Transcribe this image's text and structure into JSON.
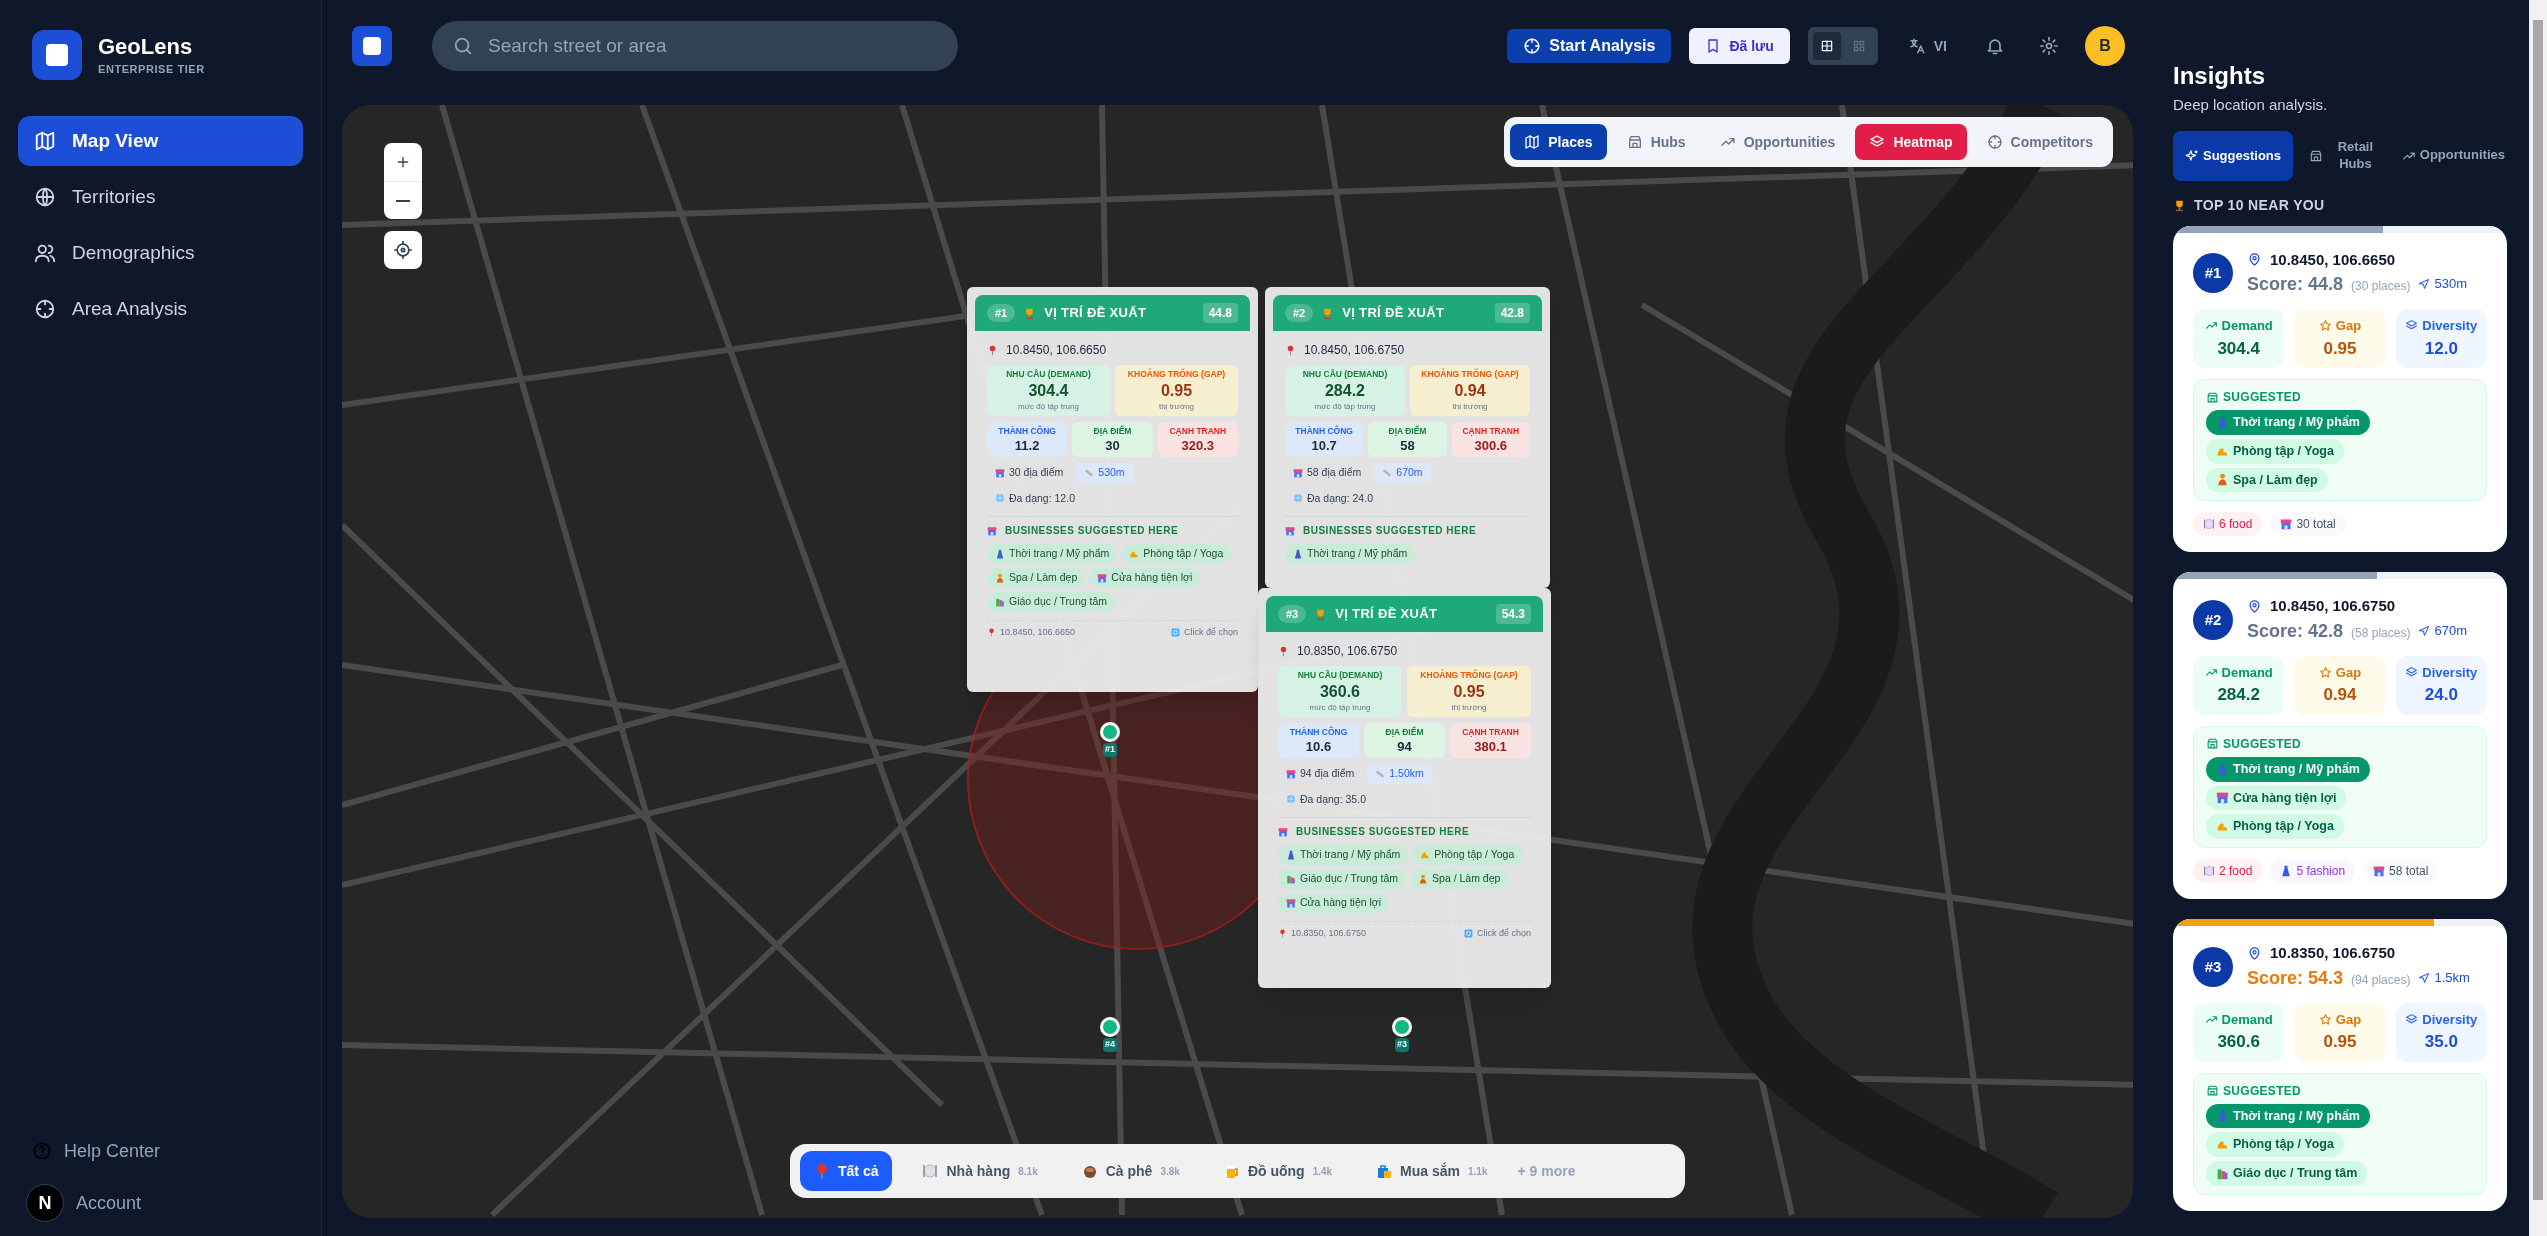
{
  "sidebar": {
    "brand": "GeoLens",
    "tier": "ENTERPRISE TIER",
    "items": [
      {
        "label": "Map View",
        "selected": true,
        "kind": "map"
      },
      {
        "label": "Territories",
        "selected": false,
        "kind": "globe"
      },
      {
        "label": "Demographics",
        "selected": false,
        "kind": "users"
      },
      {
        "label": "Area Analysis",
        "selected": false,
        "kind": "crosshair"
      }
    ],
    "footer_items": [
      {
        "label": "Help Center",
        "kind": "help"
      },
      {
        "label": "Account",
        "kind": "account"
      }
    ],
    "dev_badge": "N"
  },
  "topbar": {
    "search": {
      "placeholder": "Search street or area"
    },
    "start_button": "Start Analysis",
    "saved_button": "Đã lưu",
    "view_toggle": [
      {
        "kind": "grid",
        "selected": true
      },
      {
        "kind": "dots",
        "selected": false
      }
    ],
    "language": "VI",
    "avatar": "B"
  },
  "map": {
    "layers": [
      {
        "label": "Places",
        "kind": "places",
        "selected": true
      },
      {
        "label": "Hubs",
        "kind": "hubs",
        "selected": false
      },
      {
        "label": "Opportunities",
        "kind": "opportunities",
        "selected": false
      },
      {
        "label": "Heatmap",
        "kind": "heatmap",
        "selected": true
      },
      {
        "label": "Competitors",
        "kind": "competitors",
        "selected": false
      }
    ],
    "markers": [
      {
        "label": "#1"
      },
      {
        "label": "#4"
      },
      {
        "label": "#3"
      }
    ],
    "popups": [
      {
        "rank": "#1",
        "title": "VỊ TRÍ ĐỀ XUẤT",
        "score": "44.8",
        "coords": "10.8450, 106.6650",
        "metrics": [
          {
            "kind": "demand",
            "label": "NHU CẦU (DEMAND)",
            "value": "304.4",
            "note": "mức độ tập trung"
          },
          {
            "kind": "gap",
            "label": "KHOẢNG TRỐNG (GAP)",
            "value": "0.95",
            "note": "thị trường"
          },
          {
            "kind": "success",
            "label": "THÀNH CÔNG",
            "value": "11.2"
          },
          {
            "kind": "places",
            "label": "ĐỊA ĐIỂM",
            "value": "30"
          },
          {
            "kind": "competition",
            "label": "CẠNH TRANH",
            "value": "320.3"
          }
        ],
        "places": "30 địa điểm",
        "distance": "530m",
        "diversity": "Đa dạng: 12.0",
        "section": "BUSINESSES SUGGESTED HERE",
        "businesses": [
          {
            "label": "Thời trang / Mỹ phẩm",
            "kind": "fashion"
          },
          {
            "label": "Phòng tập / Yoga",
            "kind": "gym"
          },
          {
            "label": "Spa / Làm đẹp",
            "kind": "spa"
          },
          {
            "label": "Cửa hàng tiện lợi",
            "kind": "store"
          },
          {
            "label": "Giáo dục / Trung tâm",
            "kind": "education"
          }
        ],
        "footer_coords": "10.8450, 106.6650",
        "footer_action": "Click để chọn"
      },
      {
        "rank": "#2",
        "title": "VỊ TRÍ ĐỀ XUẤT",
        "score": "42.8",
        "coords": "10.8450, 106.6750",
        "metrics": [
          {
            "kind": "demand",
            "label": "NHU CẦU (DEMAND)",
            "value": "284.2",
            "note": "mức độ tập trung"
          },
          {
            "kind": "gap",
            "label": "KHOẢNG TRỐNG (GAP)",
            "value": "0.94",
            "note": "thị trường"
          },
          {
            "kind": "success",
            "label": "THÀNH CÔNG",
            "value": "10.7"
          },
          {
            "kind": "places",
            "label": "ĐỊA ĐIỂM",
            "value": "58"
          },
          {
            "kind": "competition",
            "label": "CẠNH TRANH",
            "value": "300.6"
          }
        ],
        "places": "58 địa điểm",
        "distance": "670m",
        "diversity": "Đa dạng: 24.0",
        "section": "BUSINESSES SUGGESTED HERE",
        "businesses": [
          {
            "label": "Thời trang / Mỹ phẩm",
            "kind": "fashion"
          }
        ]
      },
      {
        "rank": "#3",
        "title": "VỊ TRÍ ĐỀ XUẤT",
        "score": "54.3",
        "coords": "10.8350, 106.6750",
        "metrics": [
          {
            "kind": "demand",
            "label": "NHU CẦU (DEMAND)",
            "value": "360.6",
            "note": "mức độ tập trung"
          },
          {
            "kind": "gap",
            "label": "KHOẢNG TRỐNG (GAP)",
            "value": "0.95",
            "note": "thị trường"
          },
          {
            "kind": "success",
            "label": "THÀNH CÔNG",
            "value": "10.6"
          },
          {
            "kind": "places",
            "label": "ĐỊA ĐIỂM",
            "value": "94"
          },
          {
            "kind": "competition",
            "label": "CẠNH TRANH",
            "value": "380.1"
          }
        ],
        "places": "94 địa điểm",
        "distance": "1.50km",
        "diversity": "Đa dạng: 35.0",
        "section": "BUSINESSES SUGGESTED HERE",
        "businesses": [
          {
            "label": "Thời trang / Mỹ phẩm",
            "kind": "fashion"
          },
          {
            "label": "Phòng tập / Yoga",
            "kind": "gym"
          },
          {
            "label": "Giáo dục / Trung tâm",
            "kind": "education"
          },
          {
            "label": "Spa / Làm đẹp",
            "kind": "spa"
          },
          {
            "label": "Cửa hàng tiện lợi",
            "kind": "store"
          }
        ],
        "footer_coords": "10.8350, 106.6750",
        "footer_action": "Click để chọn"
      }
    ],
    "categories": [
      {
        "label": "Tất cả",
        "kind": "all",
        "selected": true
      },
      {
        "label": "Nhà hàng",
        "count": "8.1k",
        "kind": "restaurant",
        "selected": false
      },
      {
        "label": "Cà phê",
        "count": "3.8k",
        "kind": "coffee",
        "selected": false
      },
      {
        "label": "Đồ uống",
        "count": "1.4k",
        "kind": "drinks",
        "selected": false
      },
      {
        "label": "Mua sắm",
        "count": "1.1k",
        "kind": "shopping",
        "selected": false
      }
    ],
    "more_categories": "+ 9 more"
  },
  "insights": {
    "title": "Insights",
    "subtitle": "Deep location analysis.",
    "tabs": [
      {
        "label": "Suggestions",
        "kind": "suggestions",
        "selected": true
      },
      {
        "label": "Retail Hubs",
        "kind": "hubs",
        "selected": false
      },
      {
        "label": "Opportunities",
        "kind": "opportunities",
        "selected": false
      }
    ],
    "section": "TOP 10 NEAR YOU",
    "cards": [
      {
        "rank": "#1",
        "coords": "10.8450, 106.6650",
        "score": "Score: 44.8",
        "places": "(30 places)",
        "distance": "530m",
        "level": 0.63,
        "color": "#94a3b8",
        "metrics": [
          {
            "kind": "demand",
            "label": "Demand",
            "value": "304.4"
          },
          {
            "kind": "gap",
            "label": "Gap",
            "value": "0.95"
          },
          {
            "kind": "diversity",
            "label": "Diversity",
            "value": "12.0"
          }
        ],
        "suggested_label": "SUGGESTED",
        "suggestions": [
          {
            "label": "Thời trang / Mỹ phẩm",
            "kind": "fashion",
            "highlighted": true
          },
          {
            "label": "Phòng tập / Yoga",
            "kind": "gym",
            "highlighted": false
          },
          {
            "label": "Spa / Làm đẹp",
            "kind": "spa",
            "highlighted": false
          }
        ],
        "tags": [
          {
            "kind": "food",
            "label": "6 food"
          },
          {
            "kind": "total",
            "label": "30 total"
          }
        ]
      },
      {
        "rank": "#2",
        "coords": "10.8450, 106.6750",
        "score": "Score: 42.8",
        "places": "(58 places)",
        "distance": "670m",
        "level": 0.61,
        "color": "#94a3b8",
        "metrics": [
          {
            "kind": "demand",
            "label": "Demand",
            "value": "284.2"
          },
          {
            "kind": "gap",
            "label": "Gap",
            "value": "0.94"
          },
          {
            "kind": "diversity",
            "label": "Diversity",
            "value": "24.0"
          }
        ],
        "suggested_label": "SUGGESTED",
        "suggestions": [
          {
            "label": "Thời trang / Mỹ phẩm",
            "kind": "fashion",
            "highlighted": true
          },
          {
            "label": "Cửa hàng tiện lợi",
            "kind": "store",
            "highlighted": false
          },
          {
            "label": "Phòng tập / Yoga",
            "kind": "gym",
            "highlighted": false
          }
        ],
        "tags": [
          {
            "kind": "food",
            "label": "2 food"
          },
          {
            "kind": "fashion",
            "label": "5 fashion"
          },
          {
            "kind": "total",
            "label": "58 total"
          }
        ]
      },
      {
        "rank": "#3",
        "coords": "10.8350, 106.6750",
        "score": "Score: 54.3",
        "places": "(94 places)",
        "distance": "1.5km",
        "level": 0.78,
        "color": "#f59e0b",
        "metrics": [
          {
            "kind": "demand",
            "label": "Demand",
            "value": "360.6"
          },
          {
            "kind": "gap",
            "label": "Gap",
            "value": "0.95"
          },
          {
            "kind": "diversity",
            "label": "Diversity",
            "value": "35.0"
          }
        ],
        "suggested_label": "SUGGESTED",
        "suggestions": [
          {
            "label": "Thời trang / Mỹ phẩm",
            "kind": "fashion",
            "highlighted": true
          },
          {
            "label": "Phòng tập / Yoga",
            "kind": "gym",
            "highlighted": false
          },
          {
            "label": "Giáo dục / Trung tâm",
            "kind": "education",
            "highlighted": false
          }
        ]
      }
    ]
  }
}
